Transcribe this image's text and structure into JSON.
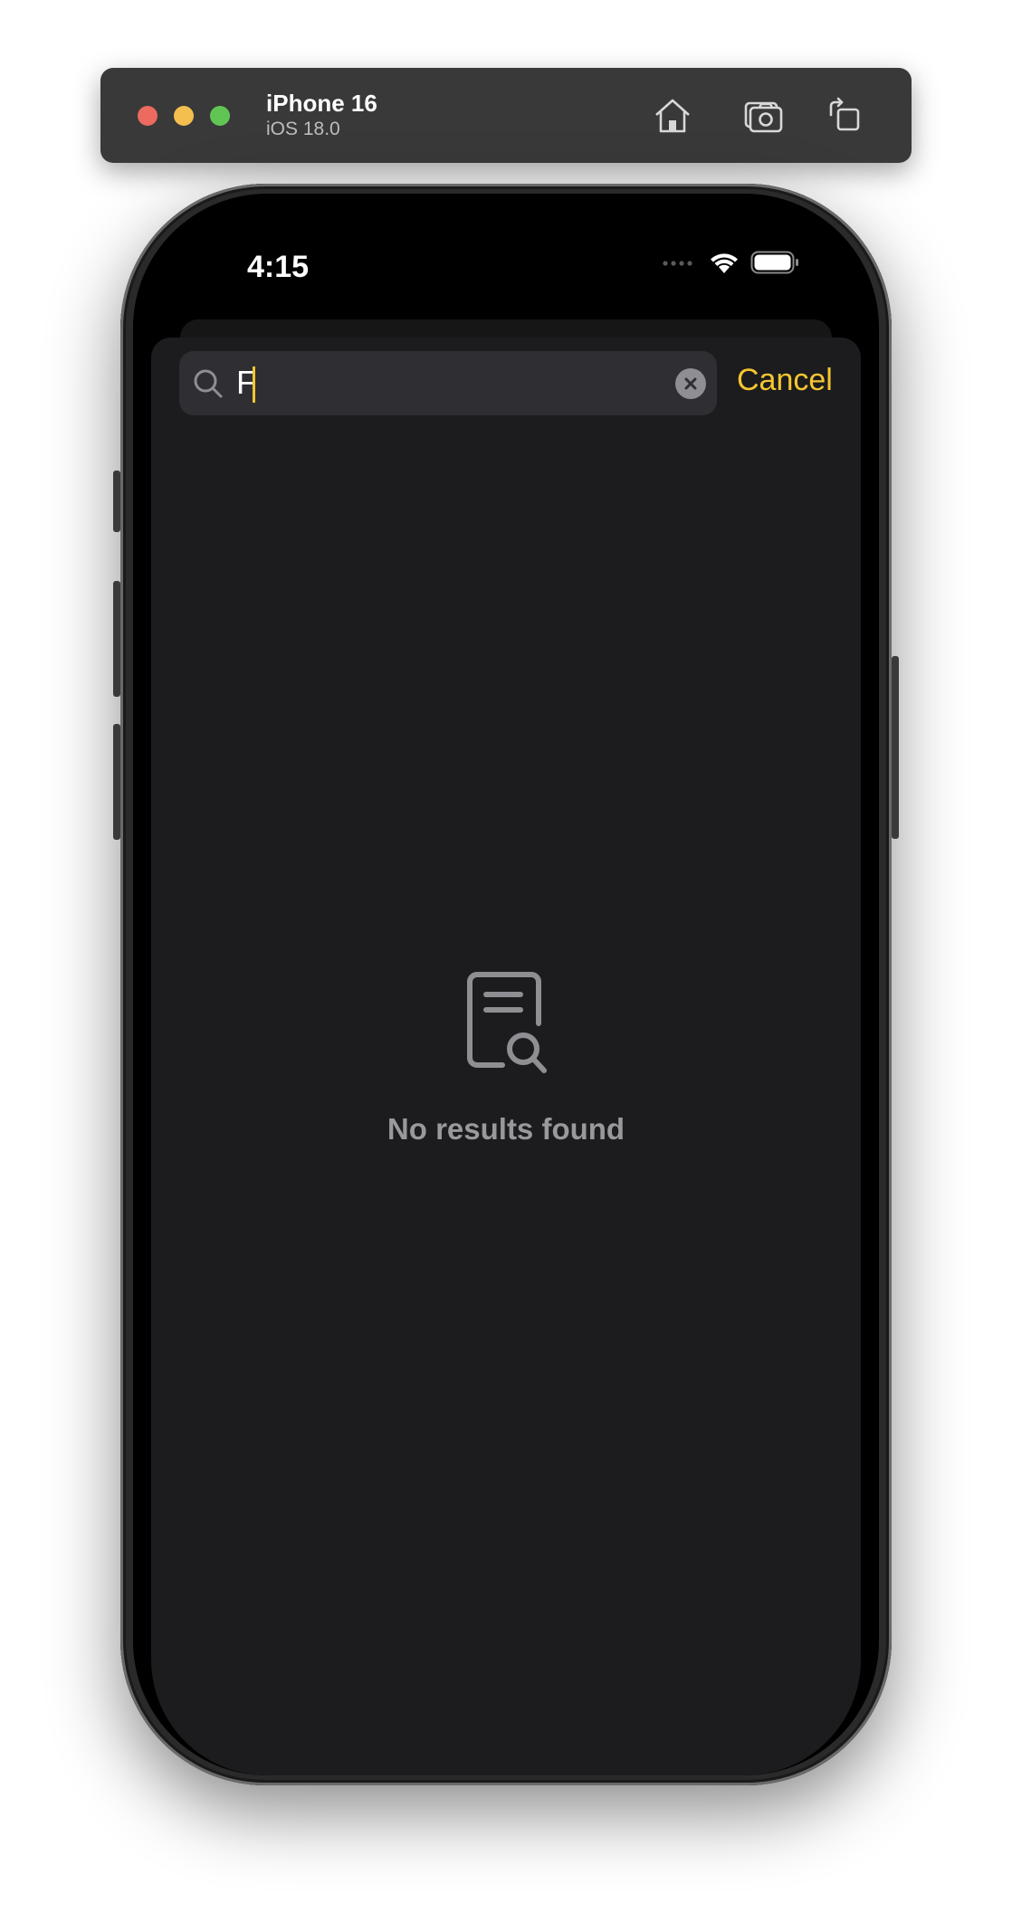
{
  "simulator": {
    "device_name": "iPhone 16",
    "os_version": "iOS 18.0",
    "icons": [
      "home-icon",
      "screenshot-icon",
      "rotate-icon"
    ]
  },
  "status_bar": {
    "time": "4:15"
  },
  "search": {
    "value": "F",
    "cancel_label": "Cancel"
  },
  "empty_state": {
    "icon": "document-search-icon",
    "message": "No results found"
  },
  "colors": {
    "accent": "#f5c62f",
    "sheet_background": "#1c1c1e",
    "search_field": "#2f2f33",
    "secondary_text": "#98989d"
  }
}
